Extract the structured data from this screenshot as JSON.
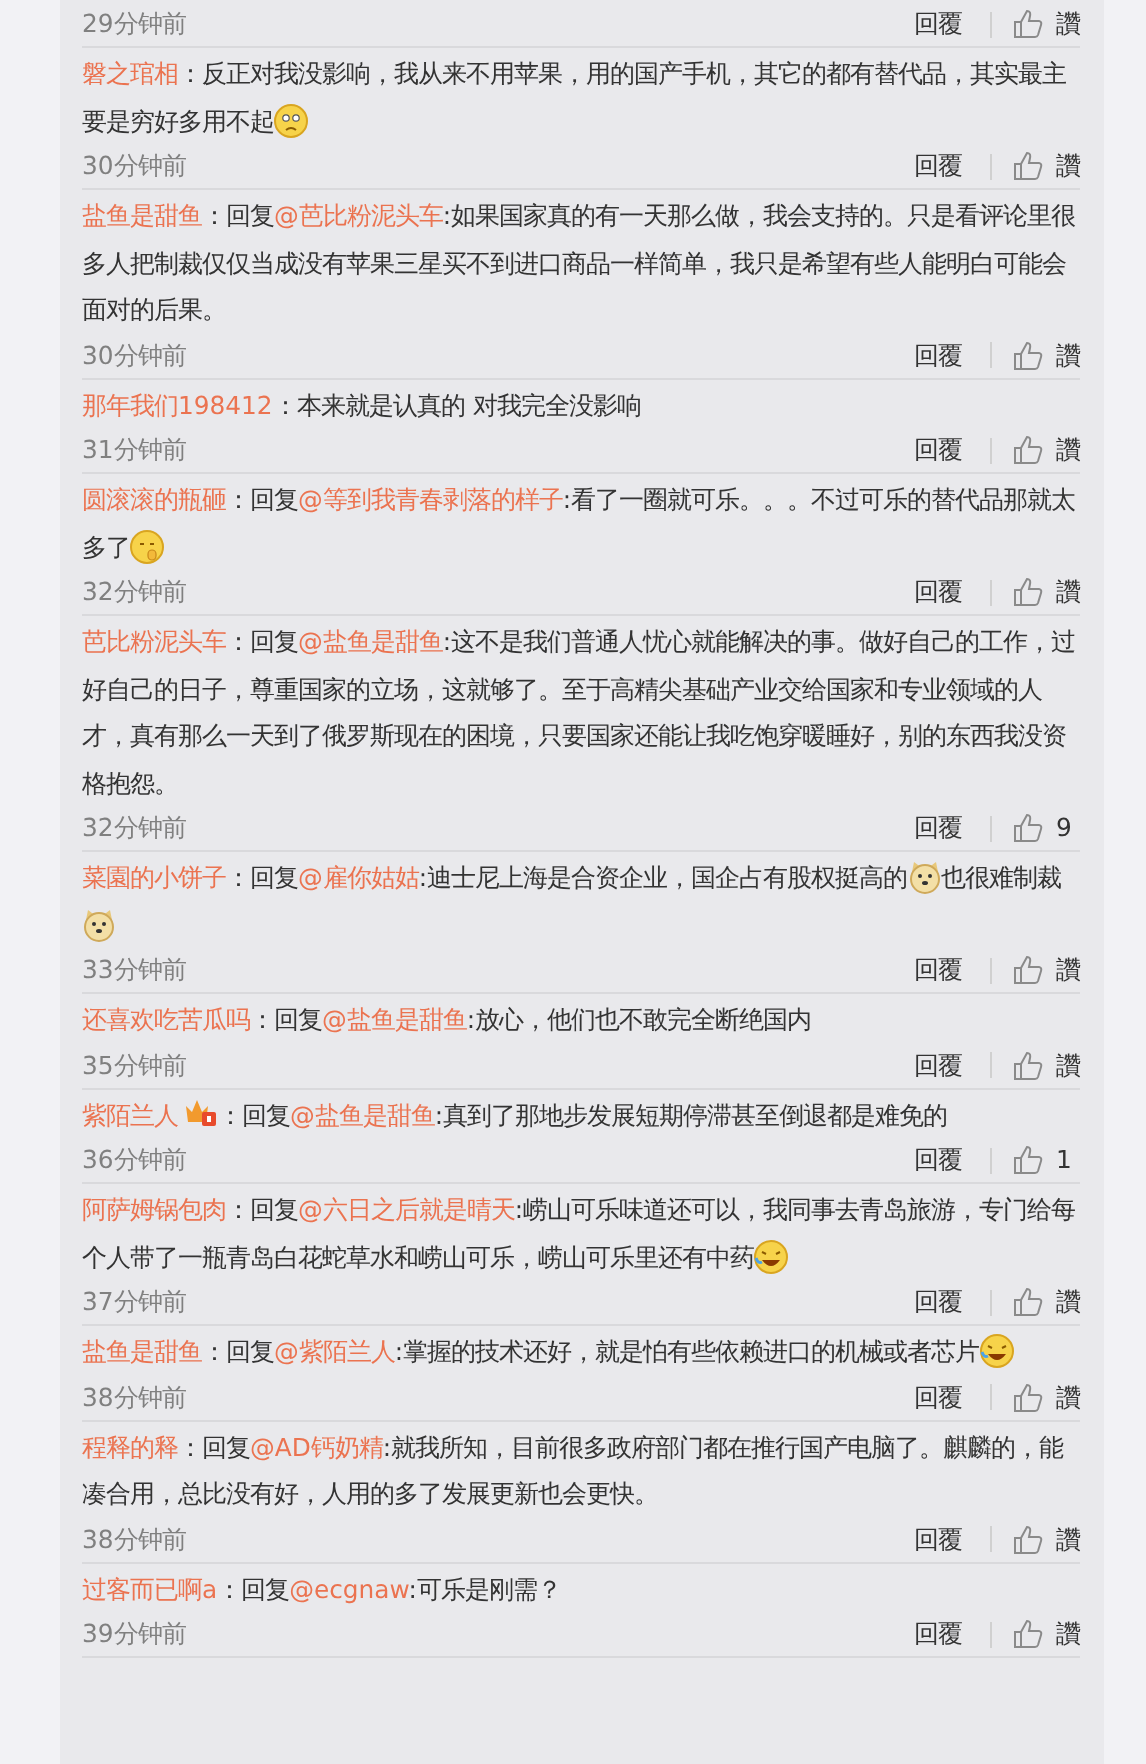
{
  "comments": [
    {
      "time": "29分钟前",
      "reply": "回覆",
      "likes": "讚"
    },
    {
      "user": "磐之琯相",
      "parts": [
        {
          "kind": "text",
          "text": "：反正对我没影响，我从来不用苹果，用的国产手机，其它的都有替代品，其实最主要是穷好多用不起"
        },
        {
          "kind": "emoji-sad"
        }
      ],
      "time": "30分钟前",
      "reply": "回覆",
      "likes": "讚"
    },
    {
      "user": "盐鱼是甜鱼",
      "parts": [
        {
          "kind": "text",
          "text": "：回复"
        },
        {
          "kind": "mention",
          "text": "@芭比粉泥头车"
        },
        {
          "kind": "text",
          "text": ":如果国家真的有一天那么做，我会支持的。只是看评论里很多人把制裁仅仅当成没有苹果三星买不到进口商品一样简单，我只是希望有些人能明白可能会面对的后果。"
        }
      ],
      "time": "30分钟前",
      "reply": "回覆",
      "likes": "讚"
    },
    {
      "user": "那年我们198412",
      "parts": [
        {
          "kind": "text",
          "text": "：本来就是认真的 对我完全没影响"
        }
      ],
      "time": "31分钟前",
      "reply": "回覆",
      "likes": "讚"
    },
    {
      "user": "圆滚滚的瓶砸",
      "parts": [
        {
          "kind": "text",
          "text": "：回复"
        },
        {
          "kind": "mention",
          "text": "@等到我青春剥落的样子"
        },
        {
          "kind": "text",
          "text": ":看了一圈就可乐。。。不过可乐的替代品那就太多了"
        },
        {
          "kind": "emoji-shush"
        }
      ],
      "time": "32分钟前",
      "reply": "回覆",
      "likes": "讚"
    },
    {
      "user": "芭比粉泥头车",
      "parts": [
        {
          "kind": "text",
          "text": "：回复"
        },
        {
          "kind": "mention",
          "text": "@盐鱼是甜鱼"
        },
        {
          "kind": "text",
          "text": ":这不是我们普通人忧心就能解决的事。做好自己的工作，过好自己的日子，尊重国家的立场，这就够了。至于高精尖基础产业交给国家和专业领域的人才，真有那么一天到了俄罗斯现在的困境，只要国家还能让我吃饱穿暖睡好，别的东西我没资格抱怨。"
        }
      ],
      "time": "32分钟前",
      "reply": "回覆",
      "likes": "9"
    },
    {
      "user": "菜園的小饼子",
      "parts": [
        {
          "kind": "text",
          "text": "：回复"
        },
        {
          "kind": "mention",
          "text": "@雇你姑姑"
        },
        {
          "kind": "text",
          "text": ":迪士尼上海是合资企业，国企占有股权挺高的"
        },
        {
          "kind": "emoji-dog"
        },
        {
          "kind": "text",
          "text": "也很难制裁"
        },
        {
          "kind": "emoji-dog"
        }
      ],
      "time": "33分钟前",
      "reply": "回覆",
      "likes": "讚"
    },
    {
      "user": "还喜欢吃苦瓜吗",
      "parts": [
        {
          "kind": "text",
          "text": "：回复"
        },
        {
          "kind": "mention",
          "text": "@盐鱼是甜鱼"
        },
        {
          "kind": "text",
          "text": ":放心，他们也不敢完全断绝国内"
        }
      ],
      "time": "35分钟前",
      "reply": "回覆",
      "likes": "讚"
    },
    {
      "user": "紫陌兰人",
      "badge": true,
      "parts": [
        {
          "kind": "text",
          "text": "：回复"
        },
        {
          "kind": "mention",
          "text": "@盐鱼是甜鱼"
        },
        {
          "kind": "text",
          "text": ":真到了那地步发展短期停滞甚至倒退都是难免的"
        }
      ],
      "time": "36分钟前",
      "reply": "回覆",
      "likes": "1"
    },
    {
      "user": "阿萨姆锅包肉",
      "parts": [
        {
          "kind": "text",
          "text": "：回复"
        },
        {
          "kind": "mention",
          "text": "@六日之后就是晴天"
        },
        {
          "kind": "text",
          "text": ":崂山可乐味道还可以，我同事去青岛旅游，专门给每个人带了一瓶青岛白花蛇草水和崂山可乐，崂山可乐里还有中药"
        },
        {
          "kind": "emoji-laugh"
        }
      ],
      "time": "37分钟前",
      "reply": "回覆",
      "likes": "讚"
    },
    {
      "user": "盐鱼是甜鱼",
      "parts": [
        {
          "kind": "text",
          "text": "：回复"
        },
        {
          "kind": "mention",
          "text": "@紫陌兰人"
        },
        {
          "kind": "text",
          "text": ":掌握的技术还好，就是怕有些依赖进口的机械或者芯片"
        },
        {
          "kind": "emoji-laugh"
        }
      ],
      "time": "38分钟前",
      "reply": "回覆",
      "likes": "讚"
    },
    {
      "user": "程释的释",
      "parts": [
        {
          "kind": "text",
          "text": "：回复"
        },
        {
          "kind": "mention",
          "text": "@AD钙奶精"
        },
        {
          "kind": "text",
          "text": ":就我所知，目前很多政府部门都在推行国产电脑了。麒麟的，能凑合用，总比没有好，人用的多了发展更新也会更快。"
        }
      ],
      "time": "38分钟前",
      "reply": "回覆",
      "likes": "讚"
    },
    {
      "user": "过客而已啊a",
      "parts": [
        {
          "kind": "text",
          "text": "：回复"
        },
        {
          "kind": "mention",
          "text": "@ecgnaw"
        },
        {
          "kind": "text",
          "text": ":可乐是刚需？"
        }
      ],
      "time": "39分钟前",
      "reply": "回覆",
      "likes": "讚"
    }
  ]
}
